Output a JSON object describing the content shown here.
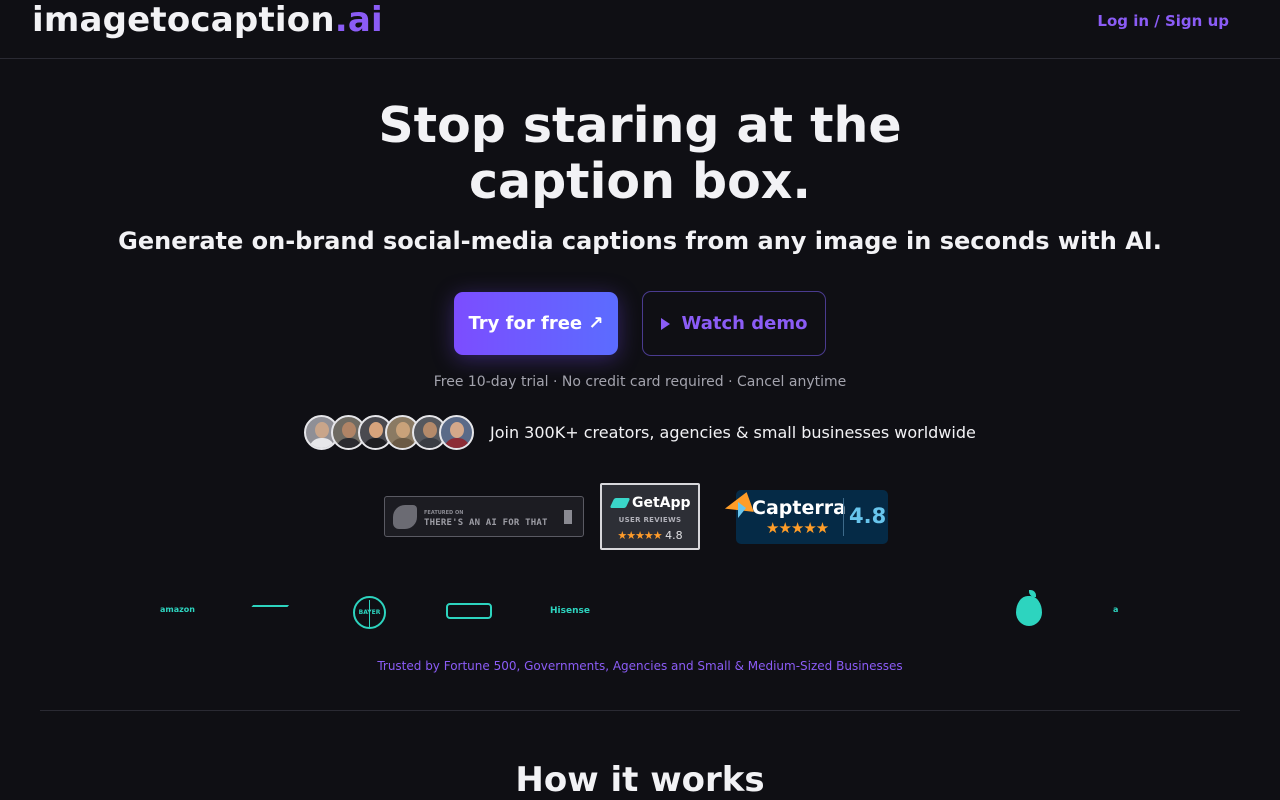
{
  "header": {
    "brand_main": "imagetocaption",
    "brand_tld": ".ai",
    "login_label": "Log in / Sign up"
  },
  "hero": {
    "title_line1": "Stop staring at the",
    "title_line2": "caption box.",
    "subtitle": "Generate on-brand social-media captions from any image in seconds with AI.",
    "primary_cta": "Try for free ↗",
    "secondary_cta": "Watch demo",
    "trial_note": "Free 10-day trial · No credit card required · Cancel anytime"
  },
  "social_proof": {
    "avatar_count": 6,
    "join_text": "Join 300K+ creators, agencies & small businesses worldwide"
  },
  "badges": {
    "aift_small": "FEATURED ON",
    "aift_big": "THERE'S AN AI FOR THAT",
    "getapp_name": "GetApp",
    "getapp_sub": "USER REVIEWS",
    "getapp_stars": "★★★★★",
    "getapp_rating": "4.8",
    "capterra_name": "Capterra",
    "capterra_stars": "★★★★★",
    "capterra_rating": "4.8"
  },
  "logos": {
    "amazon": "amazon",
    "bayer": "BAYER",
    "hisense": "Hisense",
    "partial": "a"
  },
  "trusted_text": "Trusted by Fortune 500, Governments, Agencies and Small & Medium-Sized Businesses",
  "how_title": "How it works",
  "colors": {
    "background": "#0f0f14",
    "accent": "#8b5cf6",
    "logo_teal": "#2dd4bf"
  }
}
